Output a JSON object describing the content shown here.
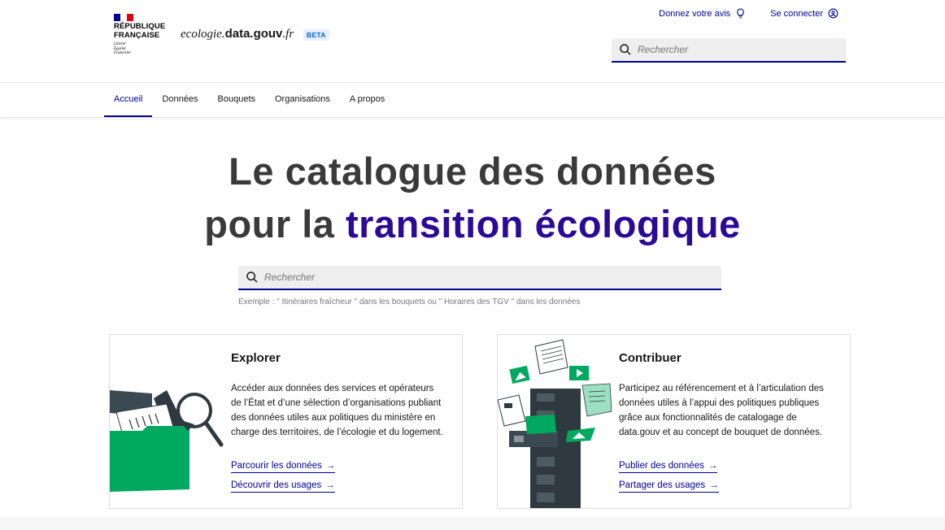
{
  "brand": {
    "rf_line1": "RÉPUBLIQUE",
    "rf_line2": "FRANÇAISE",
    "devise_1": "Liberté",
    "devise_2": "Égalité",
    "devise_3": "Fraternité",
    "site_prefix": "ecologie.",
    "site_bold": "data.gouv",
    "site_suffix": ".fr",
    "beta": "BETA",
    "flag_colors": [
      "#000091",
      "#ffffff",
      "#e1000f"
    ]
  },
  "tools": {
    "feedback_label": "Donnez votre avis",
    "feedback_icon": "lightbulb-icon",
    "login_label": "Se connecter",
    "login_icon": "user-icon"
  },
  "header_search": {
    "placeholder": "Rechercher"
  },
  "nav": {
    "items": [
      {
        "label": "Accueil",
        "active": true
      },
      {
        "label": "Données"
      },
      {
        "label": "Bouquets"
      },
      {
        "label": "Organisations"
      },
      {
        "label": "A propos"
      }
    ]
  },
  "hero": {
    "line1": "Le catalogue des données",
    "line2_prefix": "pour la ",
    "line2_highlight": "transition écologique",
    "highlight_color": "#2a0a96"
  },
  "main_search": {
    "placeholder": "Rechercher",
    "example": "Exemple : \" Itinéraires fraîcheur \" dans les bouquets ou \" Horaires des TGV \" dans les données"
  },
  "cards": [
    {
      "title": "Explorer",
      "text": "Accéder aux données des services et opérateurs de l’État et d’une sélection d’organisations publiant des données utiles aux politiques du ministère en charge des territoires, de l’écologie et du logement.",
      "link1": "Parcourir les données",
      "link2": "Découvrir des usages"
    },
    {
      "title": "Contribuer",
      "text": "Participez au référencement et à l’articulation des données utiles à l’appui des politiques publiques grâce aux fonctionnalités de catalogage de data.gouv et au concept de bouquet de données.",
      "link1": "Publier des données",
      "link2": "Partager des usages"
    }
  ],
  "colors": {
    "primary": "#000091",
    "green": "#00a95f",
    "dark": "#2e3a40"
  },
  "arrow": "→"
}
